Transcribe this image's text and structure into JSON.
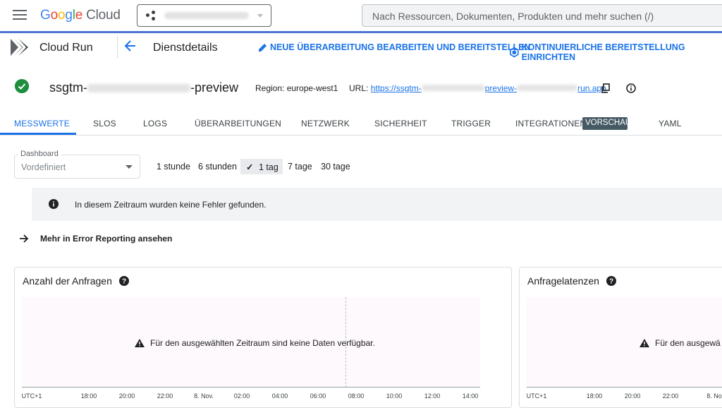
{
  "header": {
    "logo": {
      "g1": "G",
      "g2": "o",
      "g3": "o",
      "g4": "g",
      "g5": "l",
      "g6": "e",
      "cloud": "Cloud"
    },
    "search_placeholder": "Nach Ressourcen, Dokumenten, Produkten und mehr suchen (/)"
  },
  "service_bar": {
    "product": "Cloud Run",
    "page_title": "Dienstdetails",
    "action_edit": "NEUE ÜBERARBEITUNG BEARBEITEN UND BEREITSTELLEN",
    "action_cd": "KONTINUIERLICHE BEREITSTELLUNG EINRICHTEN"
  },
  "service": {
    "name_prefix": "ssgtm-",
    "name_suffix": "-preview",
    "region": "Region: europe-west1",
    "url_label": "URL:",
    "url_part1": "https://ssgtm-",
    "url_part2": "preview-",
    "url_part3": "run.app"
  },
  "tabs": [
    "MESSWERTE",
    "SLOS",
    "LOGS",
    "ÜBERARBEITUNGEN",
    "NETZWERK",
    "SICHERHEIT",
    "TRIGGER",
    "INTEGRATIONEN",
    "YAML"
  ],
  "tab_badge": "VORSCHAU",
  "dashboard": {
    "label": "Dashboard",
    "value": "Vordefiniert"
  },
  "time_ranges": [
    "1 stunde",
    "6 stunden",
    "1 tag",
    "7 tage",
    "30 tage"
  ],
  "selected_range": "1 tag",
  "notice": "In diesem Zeitraum wurden keine Fehler gefunden.",
  "more_link": "Mehr in Error Reporting ansehen",
  "cards": {
    "requests": {
      "title": "Anzahl der Anfragen",
      "nodata": "Für den ausgewählten Zeitraum sind keine Daten verfügbar.",
      "ticks": [
        "UTC+1",
        "18:00",
        "20:00",
        "22:00",
        "8. Nov.",
        "02:00",
        "04:00",
        "06:00",
        "08:00",
        "10:00",
        "12:00",
        "14:00"
      ]
    },
    "latency": {
      "title": "Anfragelatenzen",
      "nodata": "Für den ausgewä",
      "ticks": [
        "UTC+1",
        "18:00",
        "20:00",
        "22:00",
        "8. No"
      ]
    }
  },
  "colors": {
    "accent": "#1a73e8",
    "success": "#1e8e3e",
    "badge": "#455a64"
  }
}
